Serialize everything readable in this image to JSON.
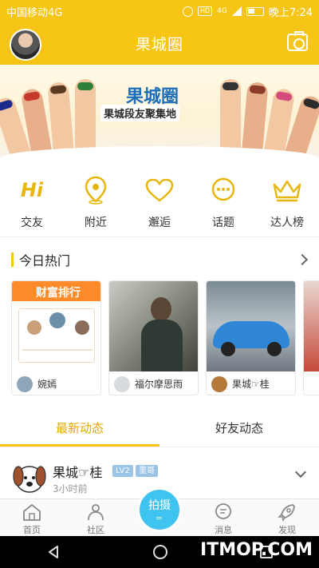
{
  "status": {
    "carrier": "中国移动4G",
    "hd": "HD",
    "signal": "4G",
    "time": "晚上7:24"
  },
  "header": {
    "title": "果城圈"
  },
  "banner": {
    "title": "果城圈",
    "subtitle": "果城段友聚集地"
  },
  "nav": [
    {
      "label": "交友",
      "icon": "hi-icon"
    },
    {
      "label": "附近",
      "icon": "location-pin-icon"
    },
    {
      "label": "邂逅",
      "icon": "heart-icon"
    },
    {
      "label": "话题",
      "icon": "chat-bubble-icon"
    },
    {
      "label": "达人榜",
      "icon": "crown-icon"
    }
  ],
  "hot": {
    "title": "今日热门",
    "cards": [
      {
        "user": "婉嫣",
        "image_caption": "财富排行"
      },
      {
        "user": "福尔摩思雨",
        "image_caption": ""
      },
      {
        "user": "果城☞桂",
        "image_caption": ""
      }
    ]
  },
  "tabs": [
    {
      "label": "最新动态",
      "active": true
    },
    {
      "label": "好友动态",
      "active": false
    }
  ],
  "post": {
    "name": "果城☞桂",
    "level": "LV2",
    "tag": "里哥",
    "time": "3小时前"
  },
  "tabbar": [
    {
      "label": "首页",
      "icon": "home-icon"
    },
    {
      "label": "社区",
      "icon": "community-icon"
    },
    {
      "label": "拍摄",
      "icon": "shoot-button"
    },
    {
      "label": "消息",
      "icon": "message-icon"
    },
    {
      "label": "发现",
      "icon": "rocket-icon"
    }
  ],
  "center": {
    "label": "拍摄",
    "sub": "═"
  },
  "watermark": "ITMOP.COM",
  "colors": {
    "accent": "#f7c515",
    "center_button": "#3fc3ef",
    "active_tab": "#e5a800"
  }
}
